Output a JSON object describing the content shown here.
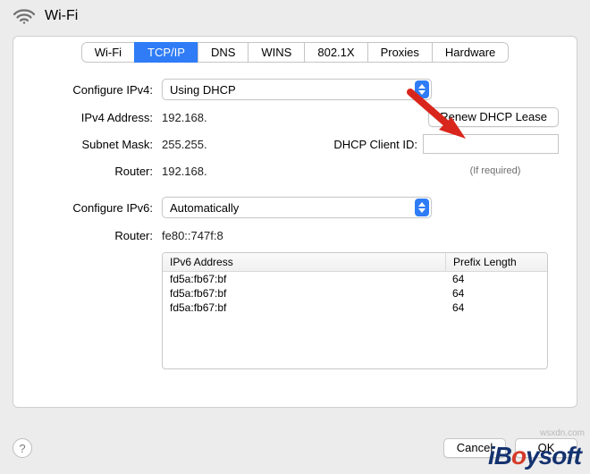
{
  "header": {
    "title": "Wi-Fi"
  },
  "tabs": [
    "Wi-Fi",
    "TCP/IP",
    "DNS",
    "WINS",
    "802.1X",
    "Proxies",
    "Hardware"
  ],
  "active_tab": "TCP/IP",
  "ipv4": {
    "configure_label": "Configure IPv4:",
    "configure_value": "Using DHCP",
    "address_label": "IPv4 Address:",
    "address_value": "192.168.",
    "subnet_label": "Subnet Mask:",
    "subnet_value": "255.255.",
    "router_label": "Router:",
    "router_value": "192.168."
  },
  "dhcp": {
    "renew_button": "Renew DHCP Lease",
    "client_id_label": "DHCP Client ID:",
    "client_id_value": "",
    "hint": "(If required)"
  },
  "ipv6": {
    "configure_label": "Configure IPv6:",
    "configure_value": "Automatically",
    "router_label": "Router:",
    "router_value": "fe80::747f:8",
    "table": {
      "col_address": "IPv6 Address",
      "col_prefix": "Prefix Length",
      "rows": [
        {
          "address": "fd5a:fb67:bf",
          "prefix": "64"
        },
        {
          "address": "fd5a:fb67:bf",
          "prefix": "64"
        },
        {
          "address": "fd5a:fb67:bf",
          "prefix": "64"
        }
      ]
    }
  },
  "footer": {
    "help": "?",
    "cancel": "Cancel",
    "ok": "OK"
  },
  "watermark": "iBoysoft",
  "wsx": "wsxdn.com"
}
